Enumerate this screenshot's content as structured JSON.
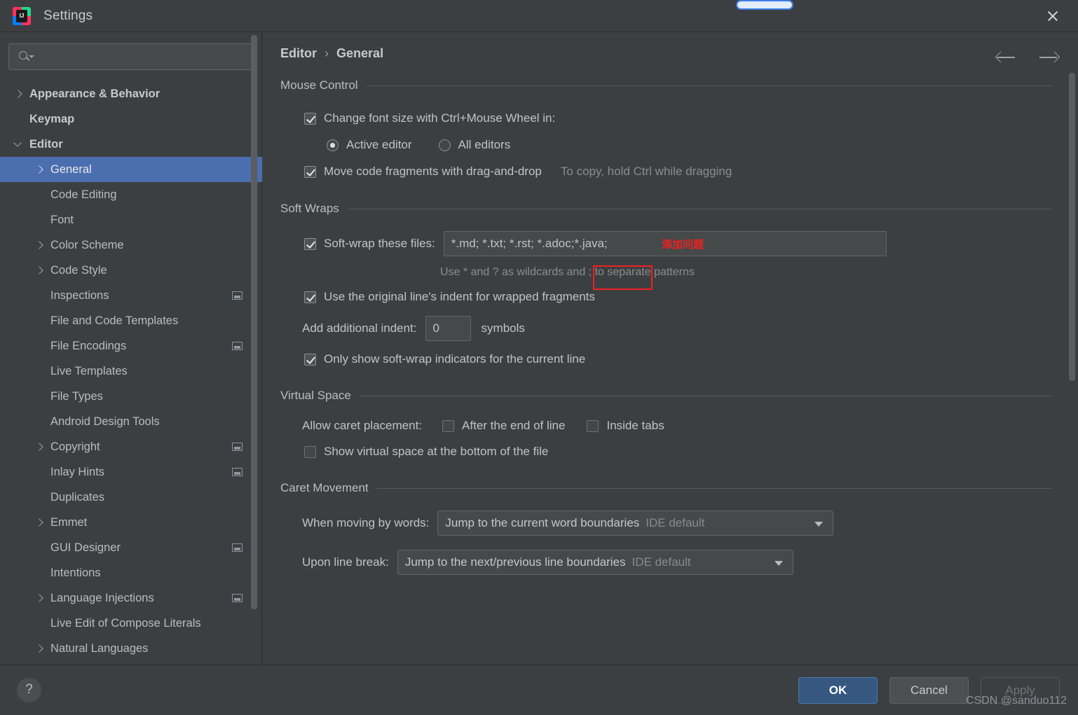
{
  "window": {
    "title": "Settings",
    "logo_text": "IJ",
    "close_label": "×"
  },
  "search": {
    "value": "",
    "placeholder": ""
  },
  "sidebar": {
    "items": [
      {
        "label": "Appearance & Behavior",
        "indent": 0,
        "bold": true,
        "chev": "right",
        "badge": false,
        "selected": false
      },
      {
        "label": "Keymap",
        "indent": 0,
        "bold": true,
        "chev": "none",
        "badge": false,
        "selected": false
      },
      {
        "label": "Editor",
        "indent": 0,
        "bold": true,
        "chev": "down",
        "badge": false,
        "selected": false
      },
      {
        "label": "General",
        "indent": 1,
        "bold": false,
        "chev": "right",
        "badge": false,
        "selected": true
      },
      {
        "label": "Code Editing",
        "indent": 1,
        "bold": false,
        "chev": "none",
        "badge": false,
        "selected": false
      },
      {
        "label": "Font",
        "indent": 1,
        "bold": false,
        "chev": "none",
        "badge": false,
        "selected": false
      },
      {
        "label": "Color Scheme",
        "indent": 1,
        "bold": false,
        "chev": "right",
        "badge": false,
        "selected": false
      },
      {
        "label": "Code Style",
        "indent": 1,
        "bold": false,
        "chev": "right",
        "badge": false,
        "selected": false
      },
      {
        "label": "Inspections",
        "indent": 1,
        "bold": false,
        "chev": "none",
        "badge": true,
        "selected": false
      },
      {
        "label": "File and Code Templates",
        "indent": 1,
        "bold": false,
        "chev": "none",
        "badge": false,
        "selected": false
      },
      {
        "label": "File Encodings",
        "indent": 1,
        "bold": false,
        "chev": "none",
        "badge": true,
        "selected": false
      },
      {
        "label": "Live Templates",
        "indent": 1,
        "bold": false,
        "chev": "none",
        "badge": false,
        "selected": false
      },
      {
        "label": "File Types",
        "indent": 1,
        "bold": false,
        "chev": "none",
        "badge": false,
        "selected": false
      },
      {
        "label": "Android Design Tools",
        "indent": 1,
        "bold": false,
        "chev": "none",
        "badge": false,
        "selected": false
      },
      {
        "label": "Copyright",
        "indent": 1,
        "bold": false,
        "chev": "right",
        "badge": true,
        "selected": false
      },
      {
        "label": "Inlay Hints",
        "indent": 1,
        "bold": false,
        "chev": "none",
        "badge": true,
        "selected": false
      },
      {
        "label": "Duplicates",
        "indent": 1,
        "bold": false,
        "chev": "none",
        "badge": false,
        "selected": false
      },
      {
        "label": "Emmet",
        "indent": 1,
        "bold": false,
        "chev": "right",
        "badge": false,
        "selected": false
      },
      {
        "label": "GUI Designer",
        "indent": 1,
        "bold": false,
        "chev": "none",
        "badge": true,
        "selected": false
      },
      {
        "label": "Intentions",
        "indent": 1,
        "bold": false,
        "chev": "none",
        "badge": false,
        "selected": false
      },
      {
        "label": "Language Injections",
        "indent": 1,
        "bold": false,
        "chev": "right",
        "badge": true,
        "selected": false
      },
      {
        "label": "Live Edit of Compose Literals",
        "indent": 1,
        "bold": false,
        "chev": "none",
        "badge": false,
        "selected": false
      },
      {
        "label": "Natural Languages",
        "indent": 1,
        "bold": false,
        "chev": "right",
        "badge": false,
        "selected": false
      }
    ]
  },
  "breadcrumb": {
    "parent": "Editor",
    "separator": "›",
    "current": "General"
  },
  "sections": {
    "mouse_control": {
      "title": "Mouse Control",
      "change_font_size": {
        "label": "Change font size with Ctrl+Mouse Wheel in:",
        "checked": true
      },
      "radio_active": {
        "label": "Active editor",
        "selected": true
      },
      "radio_all": {
        "label": "All editors",
        "selected": false
      },
      "move_fragments": {
        "label": "Move code fragments with drag-and-drop",
        "checked": true
      },
      "move_fragments_hint": "To copy, hold Ctrl while dragging"
    },
    "soft_wraps": {
      "title": "Soft Wraps",
      "soft_wrap_files": {
        "label": "Soft-wrap these files:",
        "checked": true,
        "value": "*.md; *.txt; *.rst; *.adoc;*.java;"
      },
      "wildcard_hint": "Use * and ? as wildcards and ; to separate patterns",
      "original_indent": {
        "label": "Use the original line's indent for wrapped fragments",
        "checked": true
      },
      "additional_indent": {
        "label": "Add additional indent:",
        "value": "0",
        "unit": "symbols"
      },
      "only_current_line": {
        "label": "Only show soft-wrap indicators for the current line",
        "checked": true
      },
      "annotation": {
        "text": "添加问题",
        "color": "#F02020"
      }
    },
    "virtual_space": {
      "title": "Virtual Space",
      "caret_placement_label": "Allow caret placement:",
      "after_end_of_line": {
        "label": "After the end of line",
        "checked": false
      },
      "inside_tabs": {
        "label": "Inside tabs",
        "checked": false
      },
      "show_virtual_space": {
        "label": "Show virtual space at the bottom of the file",
        "checked": false
      }
    },
    "caret_movement": {
      "title": "Caret Movement",
      "when_moving_by_words": {
        "label": "When moving by words:",
        "value": "Jump to the current word boundaries",
        "suffix": "IDE default"
      },
      "upon_line_break": {
        "label": "Upon line break:",
        "value": "Jump to the next/previous line boundaries",
        "suffix": "IDE default"
      }
    }
  },
  "footer": {
    "help": "?",
    "ok": "OK",
    "cancel": "Cancel",
    "apply": "Apply",
    "watermark": "CSDN @sanduo112"
  }
}
